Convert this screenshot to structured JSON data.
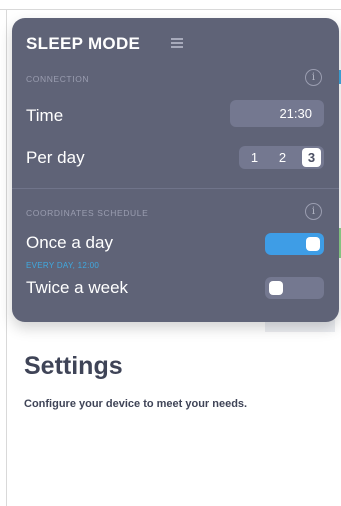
{
  "panel": {
    "title": "SLEEP MODE",
    "connection": {
      "section_label": "CONNECTION",
      "time_label": "Time",
      "time_value": "21:30",
      "per_day_label": "Per day",
      "per_day_options": [
        "1",
        "2",
        "3"
      ],
      "per_day_selected": "3"
    },
    "schedule": {
      "section_label": "COORDINATES SCHEDULE",
      "once_label": "Once a day",
      "once_sub": "EVERY DAY, 12:00",
      "once_enabled": true,
      "twice_label": "Twice a week",
      "twice_enabled": false
    }
  },
  "page": {
    "title": "Settings",
    "description": "Configure your device to meet your needs."
  },
  "icons": {
    "menu": "menu-icon",
    "info": "info-icon"
  },
  "colors": {
    "panel_bg": "#5f6377",
    "accent_blue": "#3e9de6",
    "text_dark": "#3f4457"
  }
}
